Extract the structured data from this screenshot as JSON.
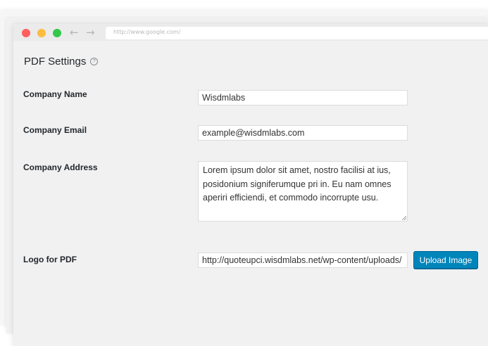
{
  "browser": {
    "url": "http://www.google.com/"
  },
  "page": {
    "title": "PDF Settings",
    "help_icon": "question-circle-icon"
  },
  "form": {
    "company_name": {
      "label": "Company Name",
      "value": "Wisdmlabs"
    },
    "company_email": {
      "label": "Company Email",
      "value": "example@wisdmlabs.com"
    },
    "company_address": {
      "label": "Company Address",
      "value": "Lorem ipsum dolor sit amet, nostro facilisi at ius, posidonium signiferumque pri in. Eu nam omnes aperiri efficiendi, et commodo incorrupte usu."
    },
    "logo": {
      "label": "Logo for PDF",
      "value": "http://quoteupci.wisdmlabs.net/wp-content/uploads/",
      "button_label": "Upload Image"
    }
  },
  "colors": {
    "primary_button": "#0085ba",
    "window_bg": "#f1f1f1"
  }
}
